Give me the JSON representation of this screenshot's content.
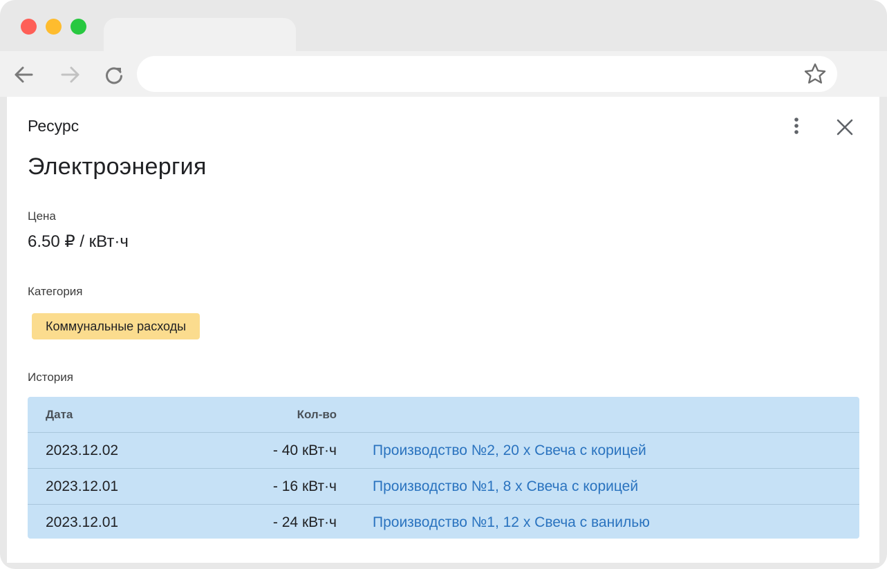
{
  "browser": {
    "address_value": "",
    "colors": {
      "close": "#fe5f57",
      "minimize": "#febc2e",
      "maximize": "#28c840"
    },
    "icons": [
      "back-arrow-icon",
      "forward-arrow-icon",
      "reload-icon",
      "star-icon"
    ]
  },
  "panel": {
    "overline": "Ресурс",
    "title": "Электроэнергия",
    "price_label": "Цена",
    "price_value": "6.50 ₽ / кВт·ч",
    "category_label": "Категория",
    "category_chip": "Коммунальные расходы",
    "history_label": "История",
    "icons": [
      "more-vert-icon",
      "close-icon"
    ]
  },
  "history": {
    "columns": [
      "Дата",
      "Кол-во",
      ""
    ],
    "rows": [
      {
        "date": "2023.12.02",
        "qty": "- 40 кВт·ч",
        "source": "Производство №2, 20 x Свеча с корицей"
      },
      {
        "date": "2023.12.01",
        "qty": "- 16 кВт·ч",
        "source": "Производство №1, 8 x Свеча с корицей"
      },
      {
        "date": "2023.12.01",
        "qty": "- 24 кВт·ч",
        "source": "Производство №1, 12 x Свеча с ванилью"
      }
    ]
  },
  "colors": {
    "chip_bg": "#fbdc8e",
    "table_bg": "#c6e1f6",
    "link": "#2a73bf"
  }
}
